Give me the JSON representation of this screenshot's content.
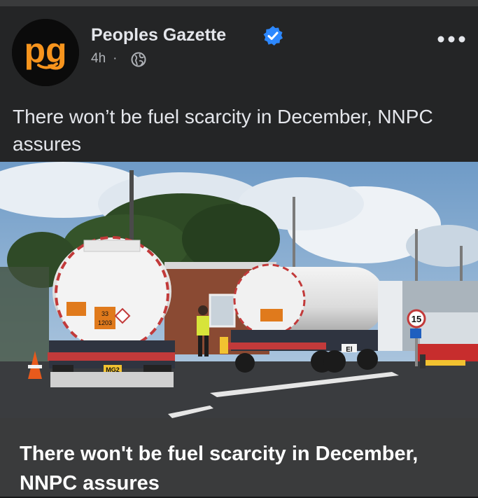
{
  "post": {
    "page_name": "Peoples Gazette",
    "time": "4h",
    "separator": "·",
    "caption": "There won’t be fuel scarcity in December, NNPC assures",
    "avatar_text": "pg",
    "icons": {
      "verified": "verified-badge-icon",
      "audience": "globe-icon",
      "menu": "more-options-icon"
    },
    "colors": {
      "brand_orange": "#f7941d",
      "verified_blue": "#2d88ff"
    }
  },
  "image": {
    "tanker1": {
      "placards": [
        "33",
        "1203"
      ],
      "plate": "MG2"
    },
    "tanker2": {
      "plate": "El"
    },
    "speed_sign": "15"
  },
  "link_preview": {
    "title": "There won't be fuel scarcity in December, NNPC assures"
  }
}
